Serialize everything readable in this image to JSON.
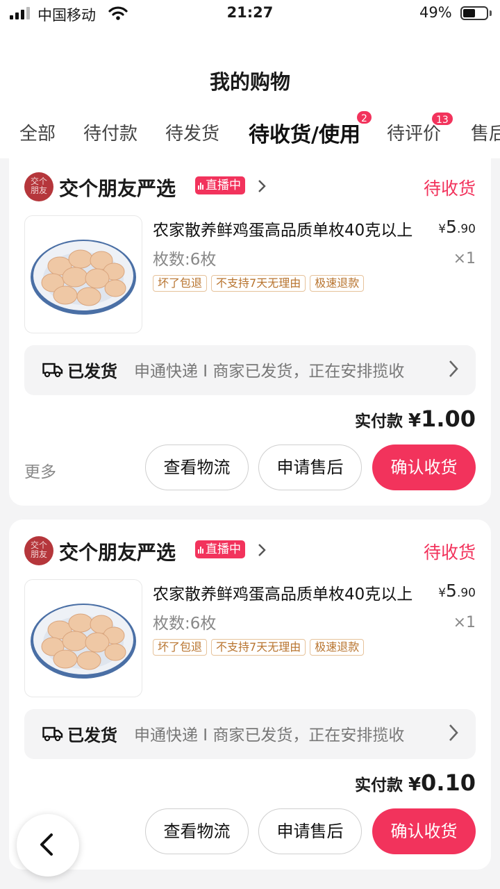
{
  "status_bar": {
    "carrier": "中国移动",
    "time": "21:27",
    "battery": "49%",
    "battery_level": 0.49
  },
  "header": {
    "title": "我的购物"
  },
  "tabs": [
    {
      "label": "全部",
      "badge": ""
    },
    {
      "label": "待付款",
      "badge": ""
    },
    {
      "label": "待发货",
      "badge": ""
    },
    {
      "label": "待收货/使用",
      "badge": "2",
      "active": true
    },
    {
      "label": "待评价",
      "badge": "13"
    },
    {
      "label": "售后",
      "badge": ""
    }
  ],
  "orders": [
    {
      "shop": {
        "name": "交个朋友严选",
        "live": "直播中",
        "logo_text": "交个朋友"
      },
      "status": "待收货",
      "product": {
        "name": "农家散养鲜鸡蛋高品质单枚40克以上",
        "spec": "枚数:6枚",
        "price_symbol": "¥",
        "price_int": "5",
        "price_dec": ".90",
        "qty": "×1",
        "tags": [
          "坏了包退",
          "不支持7天无理由",
          "极速退款"
        ]
      },
      "shipping": {
        "label": "已发货",
        "detail": "申通快递 I 商家已发货，正在安排揽收"
      },
      "paid": {
        "label": "实付款",
        "symbol": "¥",
        "int": "1",
        "dec": ".00"
      },
      "more": "更多",
      "buttons": {
        "logistics": "查看物流",
        "aftersale": "申请售后",
        "confirm": "确认收货"
      }
    },
    {
      "shop": {
        "name": "交个朋友严选",
        "live": "直播中",
        "logo_text": "交个朋友"
      },
      "status": "待收货",
      "product": {
        "name": "农家散养鲜鸡蛋高品质单枚40克以上",
        "spec": "枚数:6枚",
        "price_symbol": "¥",
        "price_int": "5",
        "price_dec": ".90",
        "qty": "×1",
        "tags": [
          "坏了包退",
          "不支持7天无理由",
          "极速退款"
        ]
      },
      "shipping": {
        "label": "已发货",
        "detail": "申通快递 I 商家已发货，正在安排揽收"
      },
      "paid": {
        "label": "实付款",
        "symbol": "¥",
        "int": "0",
        "dec": ".10"
      },
      "buttons": {
        "logistics": "查看物流",
        "aftersale": "申请售后",
        "confirm": "确认收货"
      }
    }
  ],
  "icons": {
    "back": "chevron-left-icon",
    "truck": "truck-icon",
    "chevron": "chevron-right-icon"
  },
  "colors": {
    "accent": "#f2335c",
    "tag_border": "#e6c29a",
    "tag_text": "#b8742f",
    "background": "#f4f4f5"
  }
}
